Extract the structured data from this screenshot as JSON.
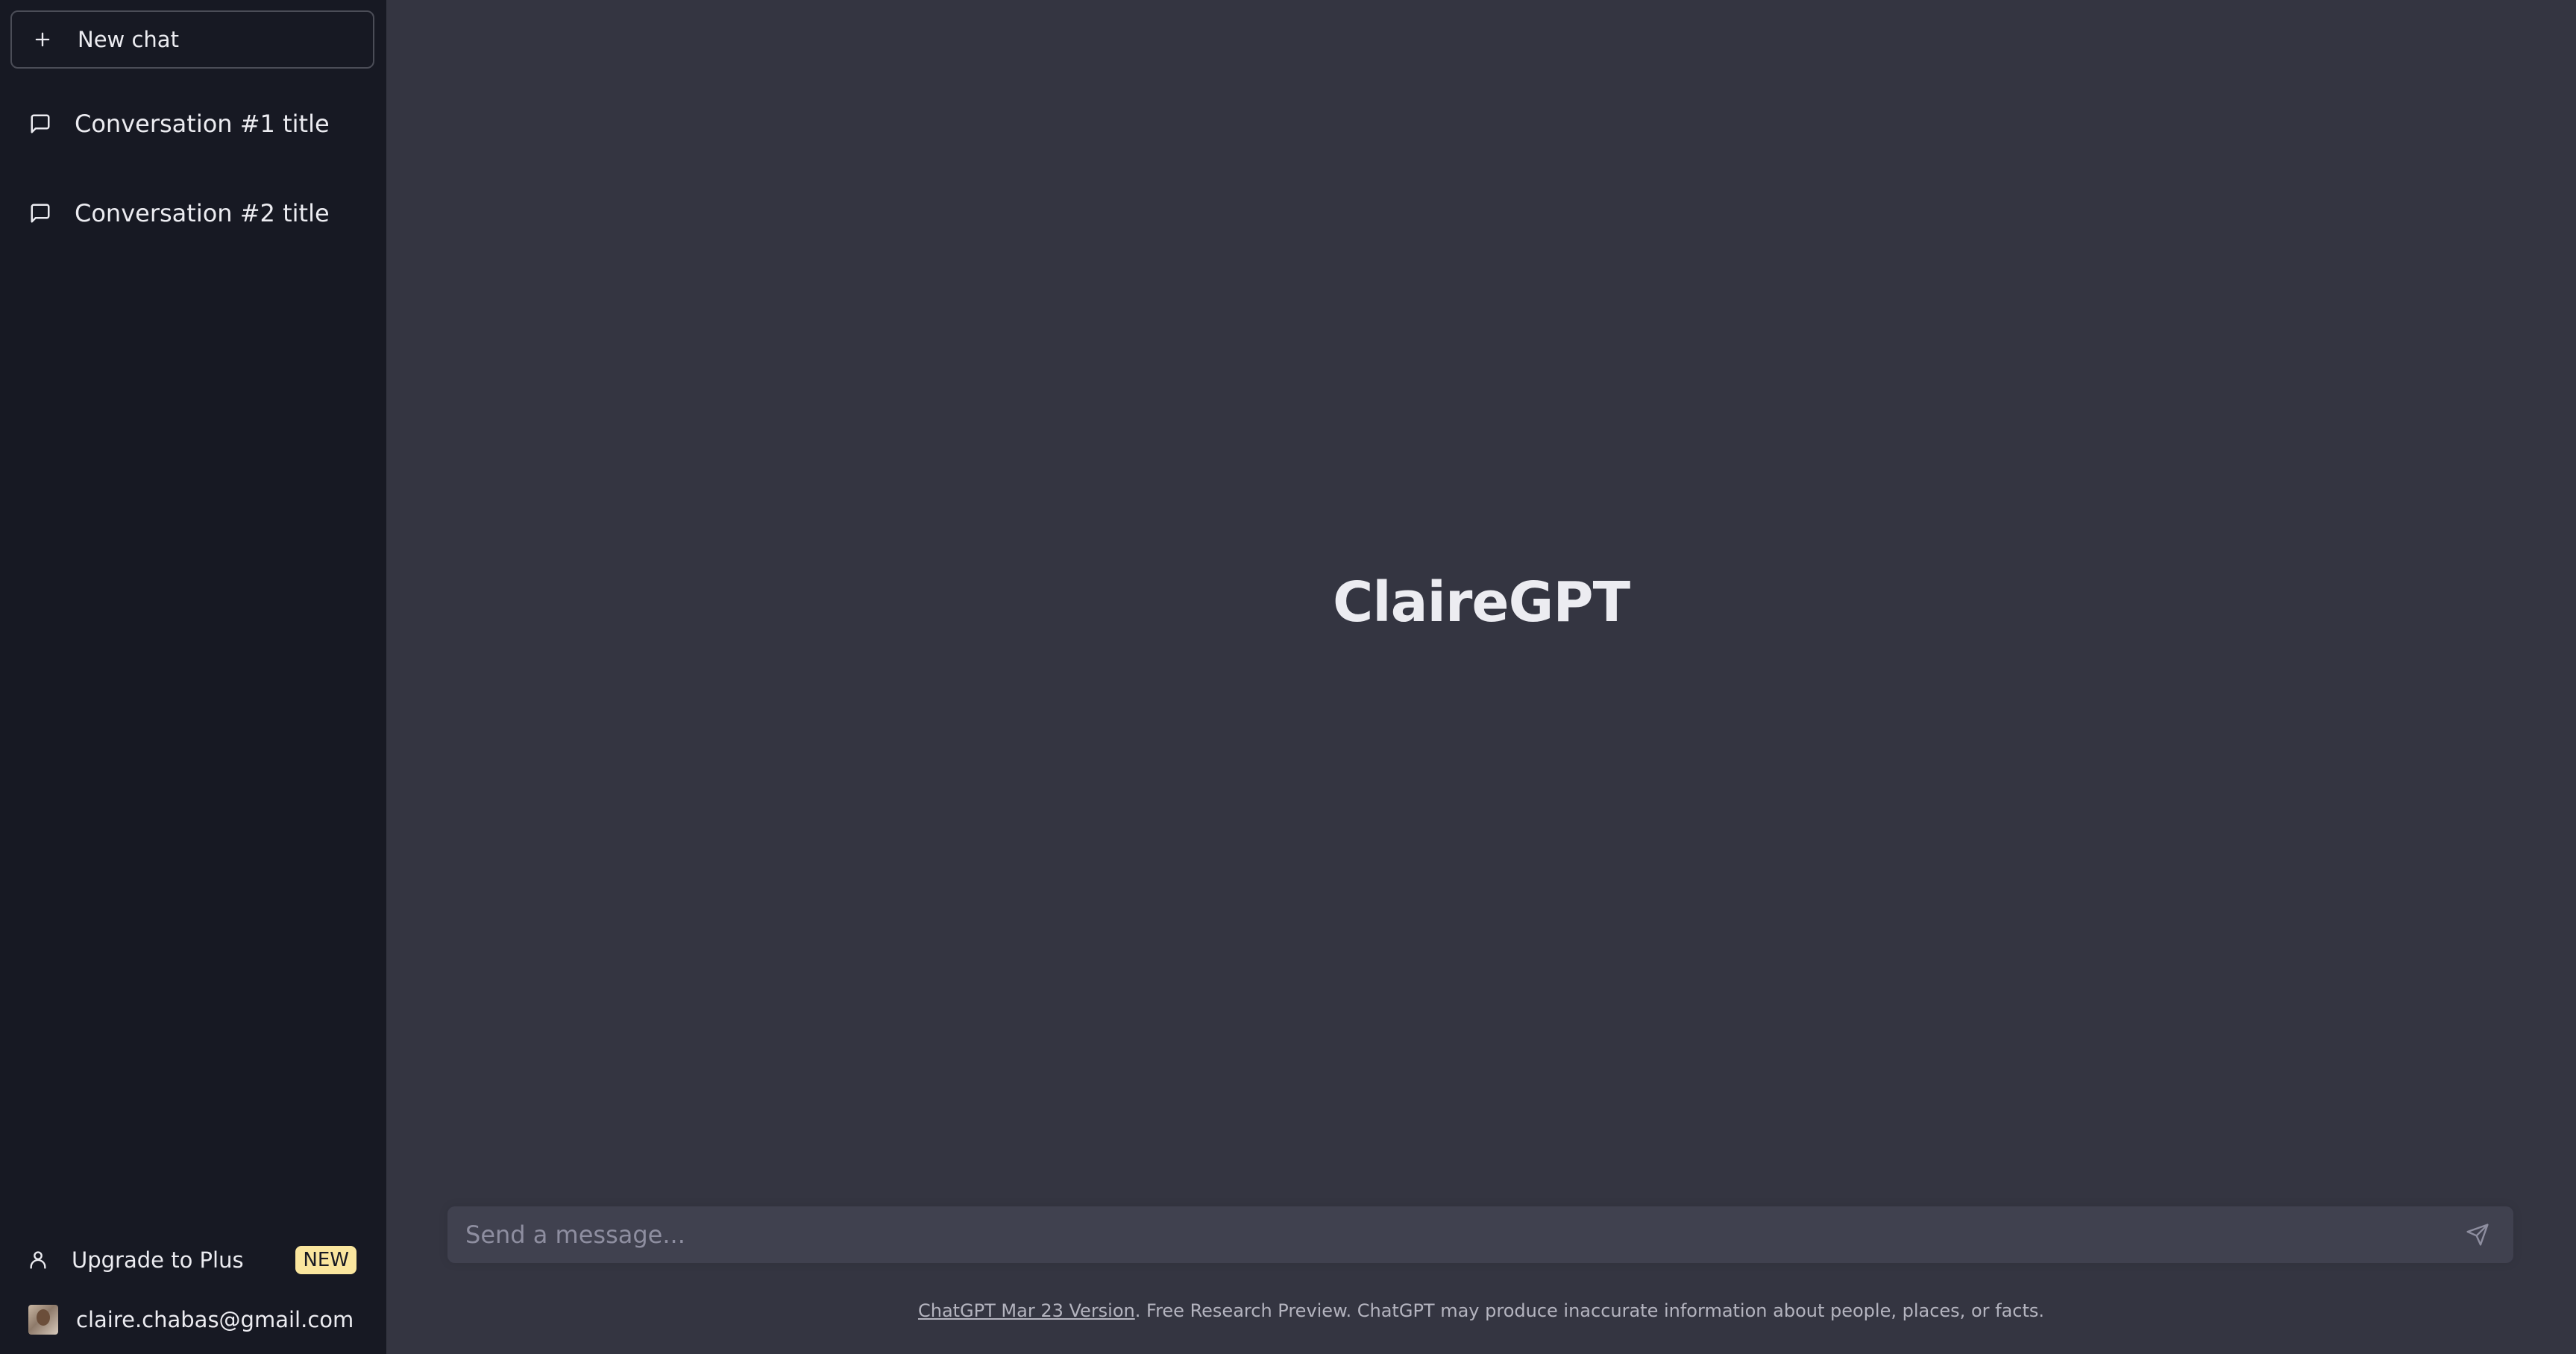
{
  "sidebar": {
    "new_chat_label": "New chat",
    "conversations": [
      {
        "label": "Conversation #1 title"
      },
      {
        "label": "Conversation #2 title"
      }
    ],
    "upgrade_label": "Upgrade to Plus",
    "upgrade_badge": "NEW",
    "user_email": "claire.chabas@gmail.com"
  },
  "main": {
    "title": "ClaireGPT",
    "composer_placeholder": "Send a message...",
    "footer_link": "ChatGPT Mar 23 Version",
    "footer_text": ". Free Research Preview. ChatGPT may produce inaccurate information about people, places, or facts."
  },
  "colors": {
    "sidebar_bg": "#171923",
    "main_bg": "#343541",
    "composer_bg": "#40414f",
    "badge_bg": "#fae69e"
  },
  "icons": {
    "new_chat": "plus-icon",
    "conversation": "chat-bubble-icon",
    "upgrade": "user-icon",
    "send": "send-icon"
  }
}
